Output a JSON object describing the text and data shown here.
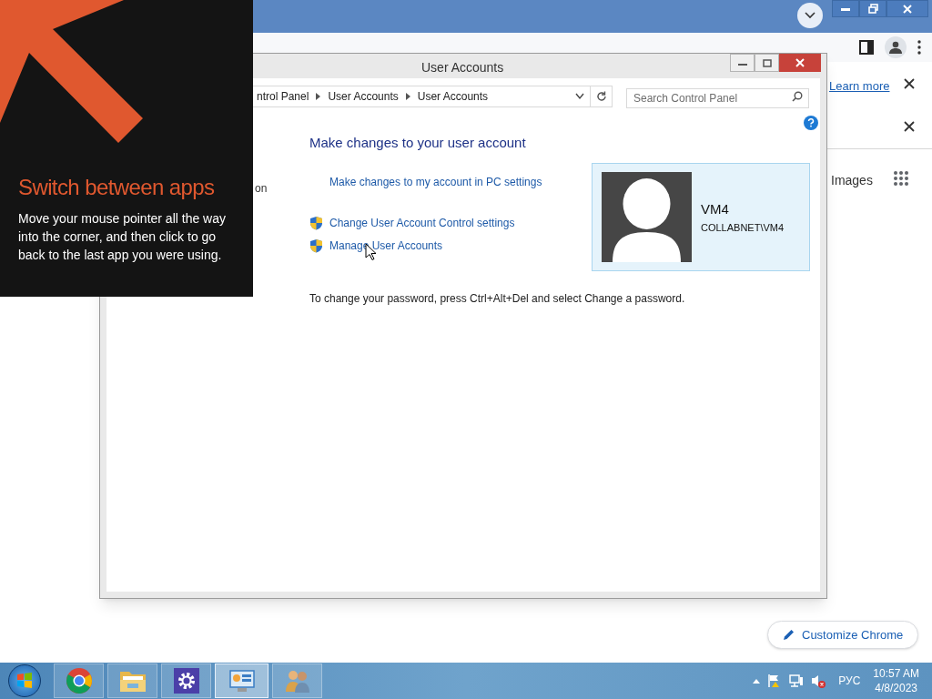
{
  "browser": {
    "learn_more": "Learn more",
    "images_link": "Images",
    "customize_button": "Customize Chrome"
  },
  "tip": {
    "title": "Switch between apps",
    "body": "Move your mouse pointer all the way into the corner, and then click to go back to the last app you were using."
  },
  "window": {
    "title": "User Accounts",
    "breadcrumb": [
      "ntrol Panel",
      "User Accounts",
      "User Accounts"
    ],
    "search": {
      "placeholder": "Search Control Panel"
    },
    "side_text": "on",
    "heading": "Make changes to your user account",
    "links": [
      {
        "text": "Make changes to my account in PC settings",
        "kind": "plain"
      },
      {
        "text": "Change User Account Control settings",
        "kind": "shield"
      },
      {
        "text": "Manage User Accounts",
        "kind": "shield"
      }
    ],
    "user": {
      "name": "VM4",
      "account": "COLLABNET\\VM4"
    },
    "note": "To change your password, press Ctrl+Alt+Del and select Change a password."
  },
  "taskbar": {
    "apps": [
      {
        "kind": "chrome",
        "selected": false
      },
      {
        "kind": "explorer",
        "selected": false
      },
      {
        "kind": "settings",
        "selected": false
      },
      {
        "kind": "control-panel",
        "selected": true
      },
      {
        "kind": "users",
        "selected": false
      }
    ],
    "language": "РУС",
    "time": "10:57 AM",
    "date": "4/8/2023"
  }
}
